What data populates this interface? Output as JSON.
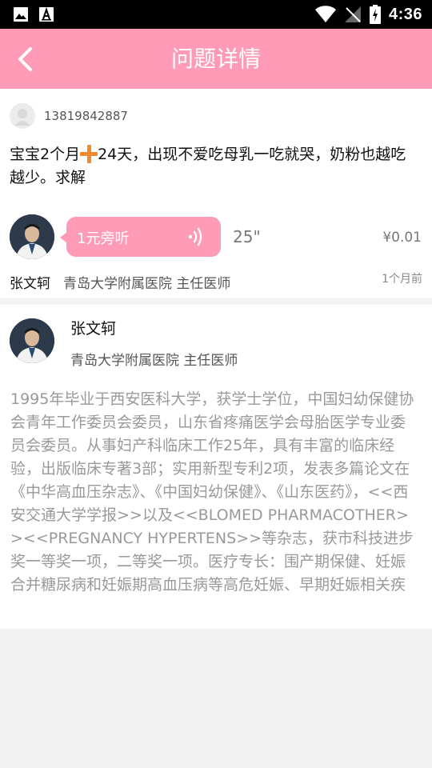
{
  "status_bar": {
    "time": "4:36",
    "icons": [
      "image-icon",
      "a-icon",
      "wifi-icon",
      "signal-icon",
      "battery-icon"
    ]
  },
  "header": {
    "title": "问题详情",
    "back_icon": "chevron-left-icon",
    "background_color": "#ff9bb7"
  },
  "question": {
    "user_phone": "13819842887",
    "text_before": "宝宝2个月",
    "text_after": "24天，出现不爱吃母乳一吃就哭，奶粉也越吃越少。求解",
    "emoji": "plus-icon"
  },
  "answer": {
    "listen_label": "1元旁听",
    "duration": "25\"",
    "price": "¥0.01",
    "doctor_name": "张文轲",
    "doctor_hospital_title": "青岛大学附属医院  主任医师",
    "time_ago": "1个月前"
  },
  "doctor_profile": {
    "name": "张文轲",
    "hospital_title": "青岛大学附属医院  主任医师",
    "bio": "1995年毕业于西安医科大学，获学士学位，中国妇幼保健协会青年工作委员会委员，山东省疼痛医学会母胎医学专业委员会委员。从事妇产科临床工作25年，具有丰富的临床经验，出版临床专著3部；实用新型专利2项，发表多篇论文在《中华高血压杂志》、《中国妇幼保健》、《山东医药》，<<西安交通大学学报>>以及<<BLOMED PHARMACOTHER>><<PREGNANCY HYPERTENS>>等杂志，获市科技进步奖一等奖一项，二等奖一项。医疗专长：围产期保健、妊娠合并糖尿病和妊娠期高血压病等高危妊娠、早期妊娠相关疾"
  }
}
